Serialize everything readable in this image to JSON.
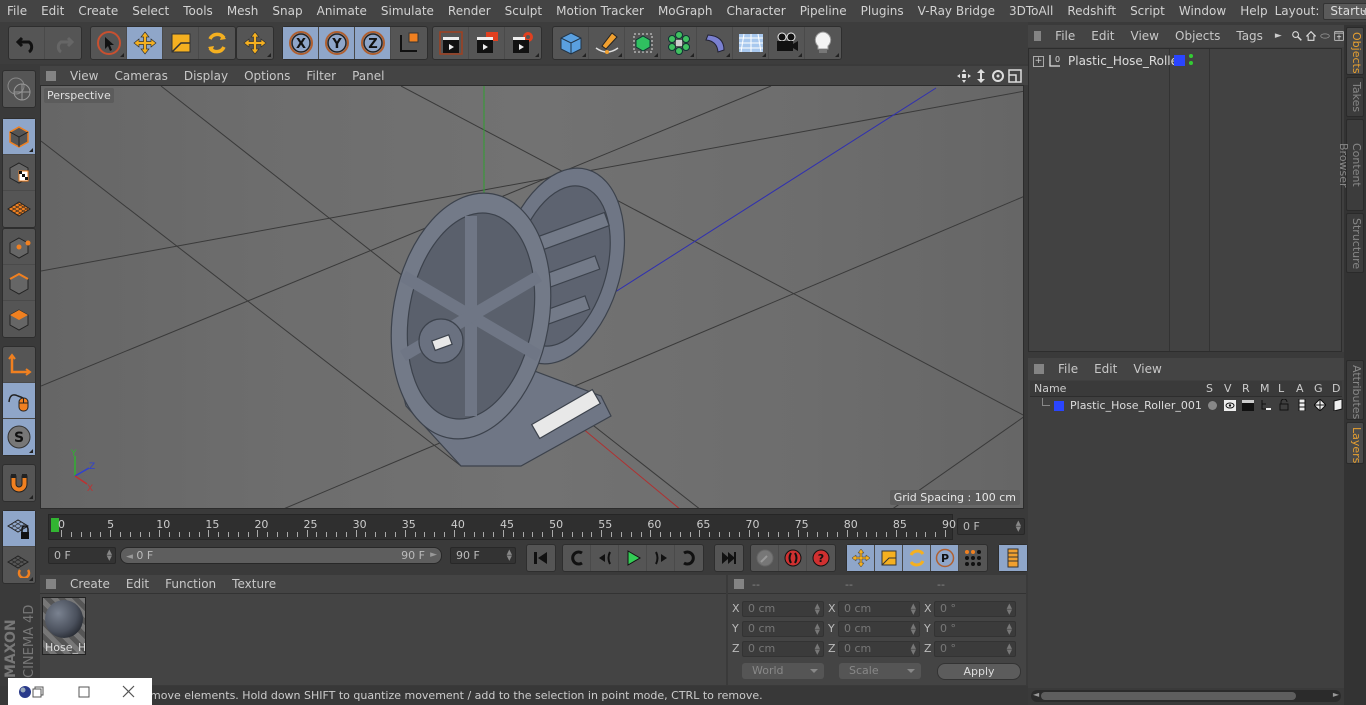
{
  "menubar": {
    "items": [
      "File",
      "Edit",
      "Create",
      "Select",
      "Tools",
      "Mesh",
      "Snap",
      "Animate",
      "Simulate",
      "Render",
      "Sculpt",
      "Motion Tracker",
      "MoGraph",
      "Character",
      "Pipeline",
      "Plugins",
      "V-Ray Bridge",
      "3DToAll",
      "Redshift",
      "Script",
      "Window",
      "Help"
    ],
    "layout_label": "Layout:",
    "layout_value": "Startup"
  },
  "toolbar": {
    "icons": [
      "undo-icon",
      "redo-icon",
      "live-selection-icon",
      "move-icon",
      "scale-icon",
      "rotate-icon",
      "recent-tool-icon",
      "x-axis-icon",
      "y-axis-icon",
      "z-axis-icon",
      "coordinate-system-icon",
      "render-view-icon",
      "render-picture-viewer-icon",
      "render-settings-icon",
      "cube-icon",
      "pen-icon",
      "subdivision-icon",
      "cloner-icon",
      "deformer-icon",
      "floor-icon",
      "camera-icon",
      "light-icon"
    ]
  },
  "viewport": {
    "menu": [
      "View",
      "Cameras",
      "Display",
      "Options",
      "Filter",
      "Panel"
    ],
    "camera_label": "Perspective",
    "grid_spacing": "Grid Spacing : 100 cm",
    "axis_labels": {
      "x": "X",
      "y": "Y",
      "z": "Z"
    },
    "colors": {
      "background": "#6b6b6b",
      "model": "#6f7685",
      "x_axis": "#c83232",
      "y_axis": "#32b432",
      "z_axis": "#3232c8"
    }
  },
  "timeline": {
    "ticks": [
      "0",
      "5",
      "10",
      "15",
      "20",
      "25",
      "30",
      "35",
      "40",
      "45",
      "50",
      "55",
      "60",
      "65",
      "70",
      "75",
      "80",
      "85",
      "90"
    ],
    "current_frame": "0 F",
    "start_field": "0 F",
    "range_start": "0 F",
    "range_end": "90 F",
    "end_field": "90 F"
  },
  "materials": {
    "menu": [
      "Create",
      "Edit",
      "Function",
      "Texture"
    ],
    "items": [
      {
        "name": "Hose_H"
      }
    ]
  },
  "coordinates": {
    "headers": [
      "--",
      "--",
      "--"
    ],
    "rows": [
      {
        "axis": "X",
        "pos": "0 cm",
        "size": "0 cm",
        "rot": "0 °"
      },
      {
        "axis": "Y",
        "pos": "0 cm",
        "size": "0 cm",
        "rot": "0 °"
      },
      {
        "axis": "Z",
        "pos": "0 cm",
        "size": "0 cm",
        "rot": "0 °"
      }
    ],
    "space_dropdown": "World",
    "mode_dropdown": "Scale",
    "apply_label": "Apply"
  },
  "status": {
    "text": "move elements. Hold down SHIFT to quantize movement / add to the selection in point mode, CTRL to remove."
  },
  "object_manager": {
    "menu": [
      "File",
      "Edit",
      "View",
      "Objects",
      "Tags"
    ],
    "objects": [
      {
        "name": "Plastic_Hose_Roller",
        "layer_color": "#2a45ff"
      }
    ]
  },
  "layer_manager": {
    "menu": [
      "File",
      "Edit",
      "View"
    ],
    "columns": [
      "Name",
      "S",
      "V",
      "R",
      "M",
      "L",
      "A",
      "G",
      "D"
    ],
    "layers": [
      {
        "name": "Plastic_Hose_Roller_001",
        "color": "#2a45ff"
      }
    ]
  },
  "side_tabs": {
    "top": [
      "Objects",
      "Takes",
      "Content Browser",
      "Structure"
    ],
    "bottom": [
      "Attributes",
      "Layers"
    ]
  },
  "branding": {
    "line1": "MAXON",
    "line2": "CINEMA 4D"
  }
}
